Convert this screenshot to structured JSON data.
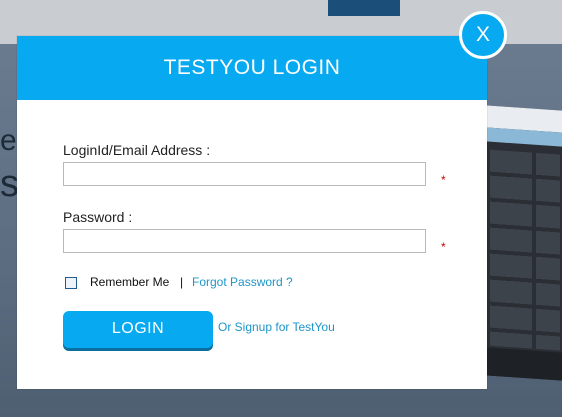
{
  "background": {
    "text_line1": "ea",
    "text_line2": "s"
  },
  "modal": {
    "title": "TESTYOU LOGIN",
    "close_label": "X",
    "login_label": "LoginId/Email Address :",
    "login_value": "",
    "login_placeholder": "",
    "password_label": "Password :",
    "password_value": "",
    "password_placeholder": "",
    "required_mark": "*",
    "remember_label": "Remember Me",
    "separator": "|",
    "forgot_link": "Forgot Password ?",
    "submit_label": "LOGIN",
    "signup_link": "Or Signup for TestYou"
  },
  "colors": {
    "accent": "#07a9f1",
    "link": "#1e95c9",
    "required": "#d40000"
  },
  "icons": {
    "close": "close-icon",
    "checkbox": "checkbox-unchecked"
  }
}
